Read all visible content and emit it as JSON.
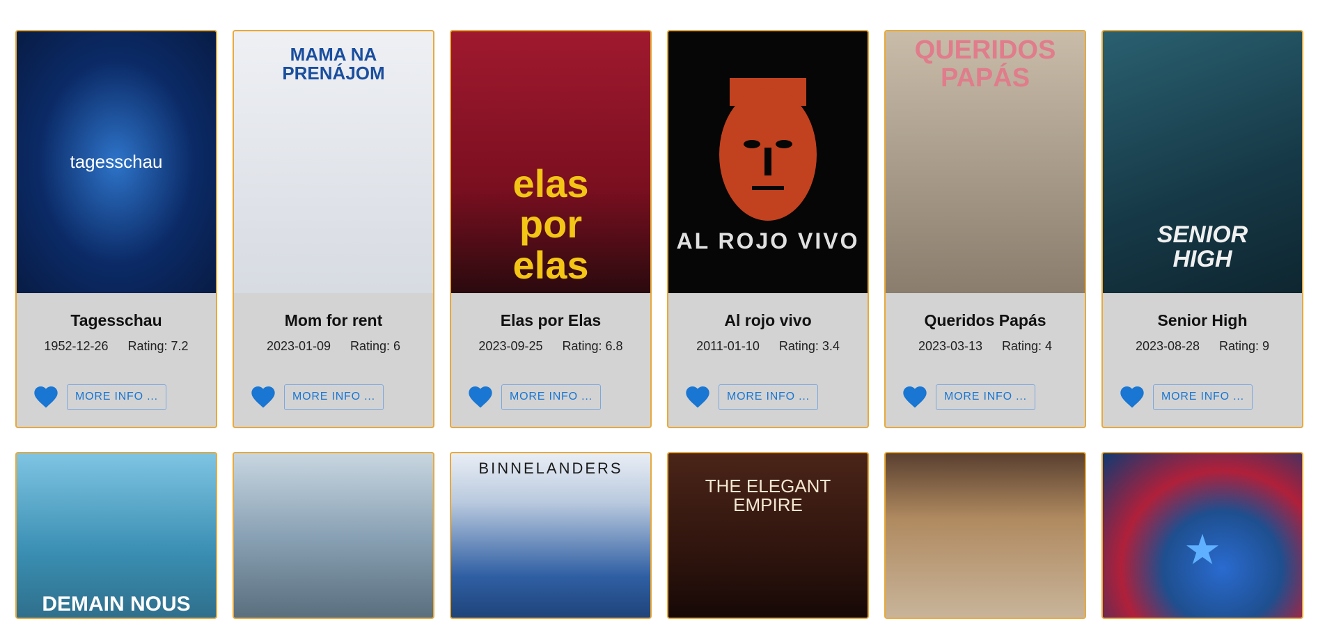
{
  "cards": [
    {
      "title": "Tagesschau",
      "date": "1952-12-26",
      "rating": "Rating: 7.2",
      "more_label": "MORE INFO ...",
      "poster_text": "tagesschau",
      "poster_bg": "#0b2a66",
      "poster_fg": "#ffffff"
    },
    {
      "title": "Mom for rent",
      "date": "2023-01-09",
      "rating": "Rating: 6",
      "more_label": "MORE INFO ...",
      "poster_text": "MAMA NA PRENÁJOM",
      "poster_bg": "#dfe2e8",
      "poster_fg": "#1a4e9e"
    },
    {
      "title": "Elas por Elas",
      "date": "2023-09-25",
      "rating": "Rating: 6.8",
      "more_label": "MORE INFO ...",
      "poster_text": "elas por elas",
      "poster_bg": "#8e1326",
      "poster_fg": "#f3c515"
    },
    {
      "title": "Al rojo vivo",
      "date": "2011-01-10",
      "rating": "Rating: 3.4",
      "more_label": "MORE INFO ...",
      "poster_text": "AL ROJO VIVO",
      "poster_bg": "#0a0a0a",
      "poster_fg": "#e0e0e0"
    },
    {
      "title": "Queridos Papás",
      "date": "2023-03-13",
      "rating": "Rating: 4",
      "more_label": "MORE INFO ...",
      "poster_text": "QUERIDOS PAPÁS",
      "poster_bg": "#b7a591",
      "poster_fg": "#e07c8b"
    },
    {
      "title": "Senior High",
      "date": "2023-08-28",
      "rating": "Rating: 9",
      "more_label": "MORE INFO ...",
      "poster_text": "SENIOR HIGH",
      "poster_bg": "#1d4a5a",
      "poster_fg": "#f0f0f0"
    }
  ],
  "row2_posters": [
    {
      "poster_text": "DEMAIN NOUS",
      "poster_bg": "#3a8fb3",
      "poster_fg": "#ffffff"
    },
    {
      "poster_text": "",
      "poster_bg": "#8aa2b5",
      "poster_fg": "#ffffff"
    },
    {
      "poster_text": "BINNELANDERS",
      "poster_bg": "#2f5fa3",
      "poster_fg": "#ffffff"
    },
    {
      "poster_text": "THE ELEGANT EMPIRE",
      "poster_bg": "#3a1a12",
      "poster_fg": "#f3e6cf"
    },
    {
      "poster_text": "",
      "poster_bg": "#8a6a4a",
      "poster_fg": "#ffffff"
    },
    {
      "poster_text": "★",
      "poster_bg": "#1e4f8f",
      "poster_fg": "#5fb0ff"
    }
  ],
  "colors": {
    "accent": "#1976d2",
    "card_border": "#e8a93a",
    "card_bg": "#d3d3d3"
  },
  "icons": {
    "favorite": "heart-icon"
  }
}
